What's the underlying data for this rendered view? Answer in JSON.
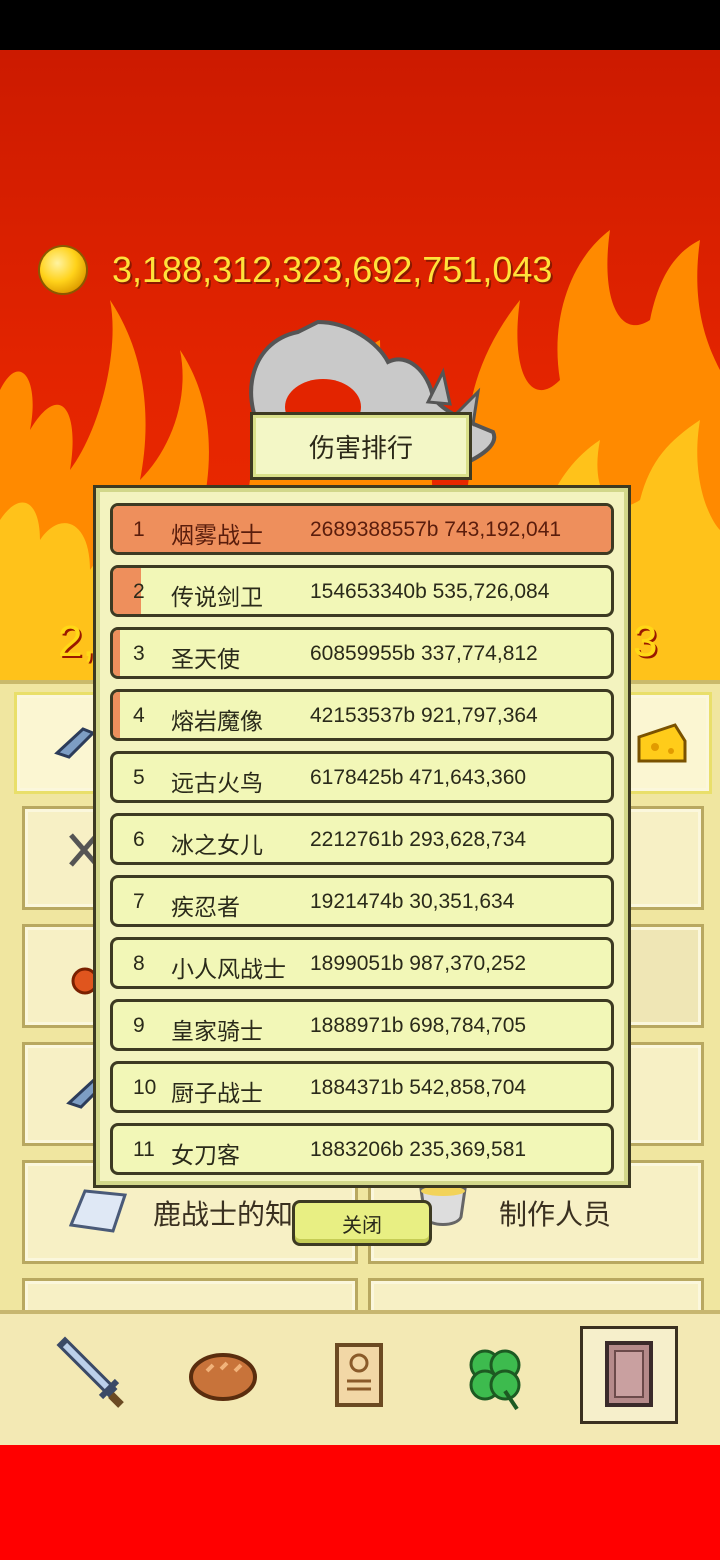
{
  "hud": {
    "gold": "3,188,312,323,692,751,043",
    "side_left": "2,",
    "side_right": "3"
  },
  "menu": {
    "knowledge_label": "鹿战士的知识",
    "credits_label": "制作人员"
  },
  "dialog": {
    "title": "伤害排行",
    "close_label": "关闭",
    "rows": [
      {
        "rank": "1",
        "name": "烟雾战士",
        "damage": "2689388557b 743,192,041",
        "share": 1.0
      },
      {
        "rank": "2",
        "name": "传说剑卫",
        "damage": "154653340b 535,726,084",
        "share": 0.058
      },
      {
        "rank": "3",
        "name": "圣天使",
        "damage": "60859955b 337,774,812",
        "share": 0.023
      },
      {
        "rank": "4",
        "name": "熔岩魔像",
        "damage": "42153537b 921,797,364",
        "share": 0.016
      },
      {
        "rank": "5",
        "name": "远古火鸟",
        "damage": "6178425b 471,643,360",
        "share": 0.002
      },
      {
        "rank": "6",
        "name": "冰之女儿",
        "damage": "2212761b 293,628,734",
        "share": 0.001
      },
      {
        "rank": "7",
        "name": "疾忍者",
        "damage": "1921474b 30,351,634",
        "share": 0.001
      },
      {
        "rank": "8",
        "name": "小人风战士",
        "damage": "1899051b 987,370,252",
        "share": 0.001
      },
      {
        "rank": "9",
        "name": "皇家骑士",
        "damage": "1888971b 698,784,705",
        "share": 0.001
      },
      {
        "rank": "10",
        "name": "厨子战士",
        "damage": "1884371b 542,858,704",
        "share": 0.001
      },
      {
        "rank": "11",
        "name": "女刀客",
        "damage": "1883206b 235,369,581",
        "share": 0.001
      }
    ]
  },
  "nav": {
    "tabs": [
      {
        "icon": "sword-icon",
        "active": false
      },
      {
        "icon": "bread-icon",
        "active": false
      },
      {
        "icon": "scroll-icon",
        "active": false
      },
      {
        "icon": "clover-icon",
        "active": false
      },
      {
        "icon": "book-icon",
        "active": true
      }
    ]
  },
  "colors": {
    "bar_fill": "#ee8f5c",
    "row_bg": "#f2f7b7",
    "gold_text": "#ffe23a"
  }
}
